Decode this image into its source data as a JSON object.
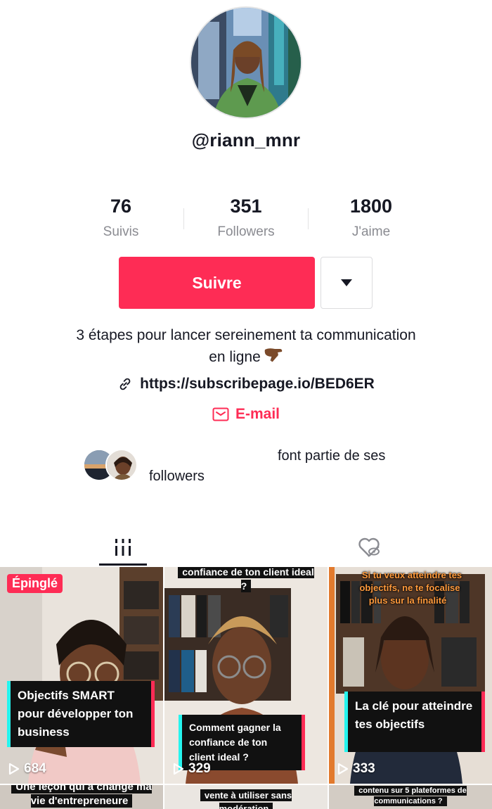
{
  "profile": {
    "username": "@riann_mnr"
  },
  "stats": [
    {
      "value": "76",
      "label": "Suivis"
    },
    {
      "value": "351",
      "label": "Followers"
    },
    {
      "value": "1800",
      "label": "J'aime"
    }
  ],
  "actions": {
    "follow_label": "Suivre",
    "more_icon": "caret-down-icon"
  },
  "bio": {
    "line1": "3 étapes pour lancer sereinement ta communication",
    "line2": "en ligne",
    "emoji": "pointing-down-hand"
  },
  "link": {
    "icon": "link-icon",
    "url": "https://subscribepage.io/BED6ER"
  },
  "email": {
    "icon": "mail-icon",
    "label": "E-mail"
  },
  "mutual": {
    "text1": "font partie de ses",
    "text2": "followers"
  },
  "tabs": [
    {
      "icon": "grid-videos-icon",
      "active": true
    },
    {
      "icon": "liked-hidden-icon",
      "active": false
    }
  ],
  "videos": [
    {
      "pinned_label": "Épinglé",
      "caption": "Objectifs SMART pour développer ton business",
      "views": "684"
    },
    {
      "top_caption": "confiance de ton client ideal ?",
      "caption": "Comment gagner la confiance de ton client ideal ?",
      "views": "329"
    },
    {
      "top_caption": "Si tu veux atteindre tes objectifs, ne te focalise plus sur la finalité",
      "caption": "La clé pour atteindre tes objectifs",
      "views": "333"
    },
    {
      "caption": "Une leçon qui a changé ma vie d'entrepreneure"
    },
    {
      "caption": "vente à utiliser sans modération"
    },
    {
      "caption": "contenu sur 5 plateformes de communications ?"
    }
  ],
  "colors": {
    "accent": "#fe2c55",
    "cyan": "#25f4ee",
    "text": "#161823",
    "muted": "#8a8b91"
  }
}
